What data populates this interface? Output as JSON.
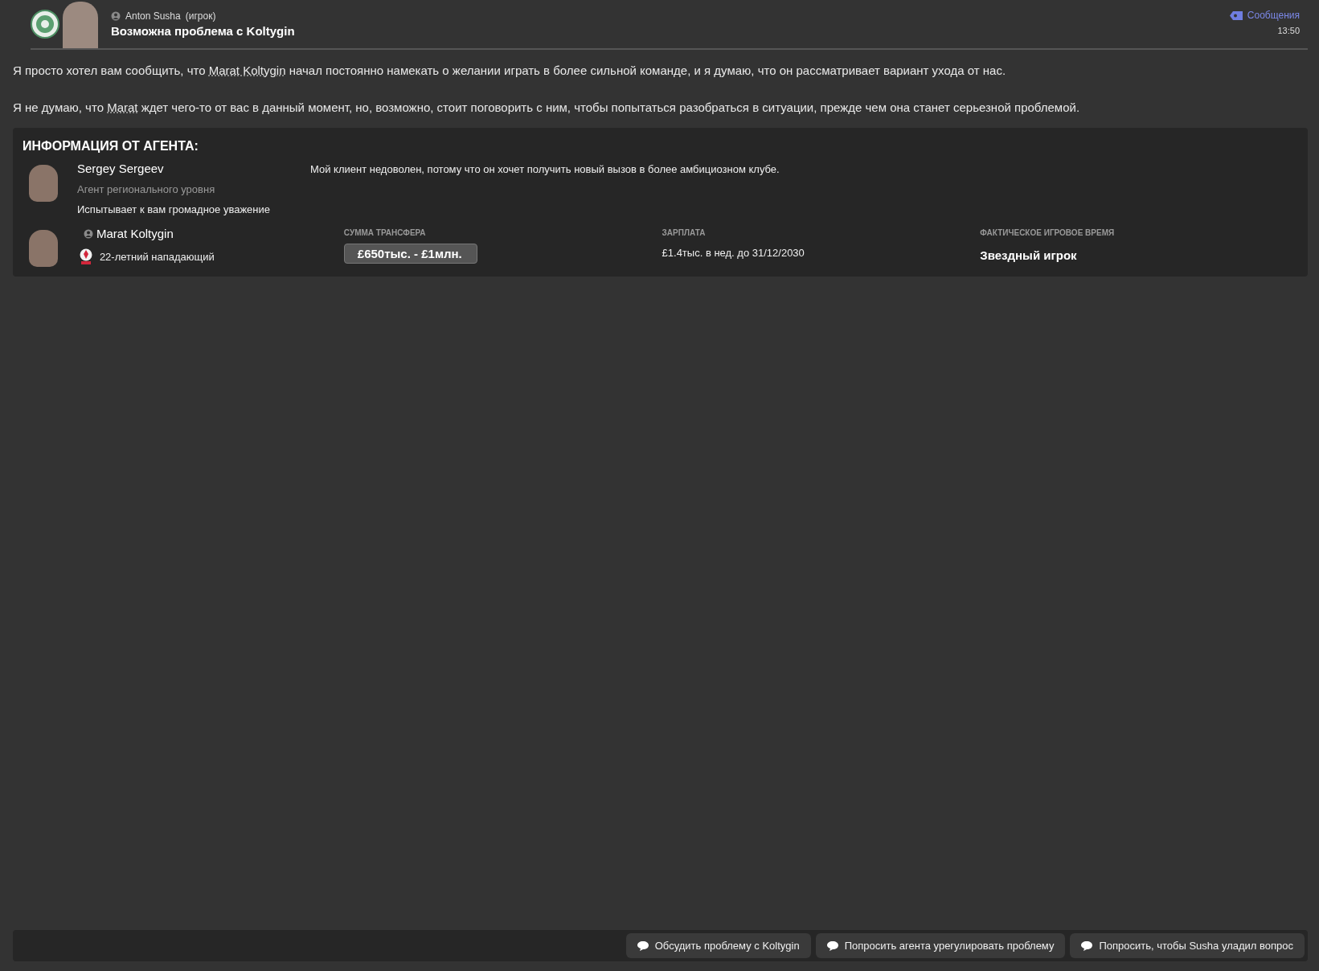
{
  "header": {
    "sender": "Anton Susha",
    "sender_role": "(игрок)",
    "subject": "Возможна проблема с Koltygin",
    "category": "Сообщения",
    "time": "13:50"
  },
  "paragraphs": [
    {
      "before": "Я просто хотел вам сообщить, что ",
      "link": "Marat Koltygin",
      "after": " начал постоянно намекать о желании играть в более сильной команде, и я думаю, что он рассматривает вариант ухода от нас."
    },
    {
      "before": "Я не думаю, что ",
      "link": "Marat",
      "after": " ждет чего-то от вас в данный момент, но, возможно, стоит поговорить с ним, чтобы попытаться разобраться в ситуации, прежде чем она станет серьезной проблемой."
    }
  ],
  "agent_info": {
    "title": "ИНФОРМАЦИЯ ОТ АГЕНТА:",
    "agent_name": "Sergey Sergeev",
    "agent_level": "Агент регионального уровня",
    "relationship": "Испытывает к вам громадное уважение",
    "quote": "Мой клиент недоволен, потому что он хочет получить новый вызов в более амбициозном клубе.",
    "player_name": "Marat Koltygin",
    "player_desc": "22-летний нападающий",
    "stats": [
      {
        "kind": "tag",
        "label": "СУММА ТРАНСФЕРА",
        "value": "£650тыс. - £1млн."
      },
      {
        "kind": "plain",
        "label": "ЗАРПЛАТА",
        "value": "£1.4тыс. в нед. до 31/12/2030"
      },
      {
        "kind": "strong",
        "label": "ФАКТИЧЕСКОЕ ИГРОВОЕ ВРЕМЯ",
        "value": "Звездный игрок"
      }
    ]
  },
  "actions": [
    "Обсудить проблему с Koltygin",
    "Попросить агента урегулировать проблему",
    "Попросить, чтобы Susha уладил вопрос"
  ]
}
